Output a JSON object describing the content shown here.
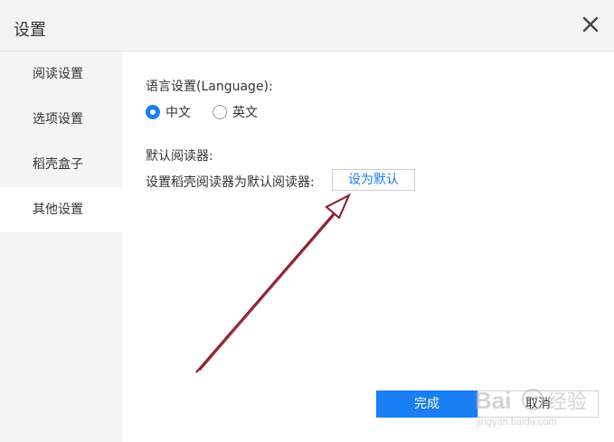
{
  "dialog": {
    "title": "设置",
    "close_icon": "close-icon"
  },
  "sidebar": {
    "items": [
      {
        "label": "阅读设置",
        "active": false
      },
      {
        "label": "选项设置",
        "active": false
      },
      {
        "label": "稻壳盒子",
        "active": false
      },
      {
        "label": "其他设置",
        "active": true
      }
    ]
  },
  "language": {
    "heading": "语言设置(Language):",
    "options": [
      {
        "label": "中文",
        "checked": true
      },
      {
        "label": "英文",
        "checked": false
      }
    ]
  },
  "default_reader": {
    "heading": "默认阅读器:",
    "description": "设置稻壳阅读器为默认阅读器:",
    "button_label": "设为默认"
  },
  "footer": {
    "ok_label": "完成",
    "cancel_label": "取消"
  },
  "colors": {
    "accent": "#1a7ef5",
    "annotation_arrow": "#8b1a2b",
    "sidebar_bg": "#f4f4f4",
    "titlebar_bg": "#f3f3f3"
  }
}
